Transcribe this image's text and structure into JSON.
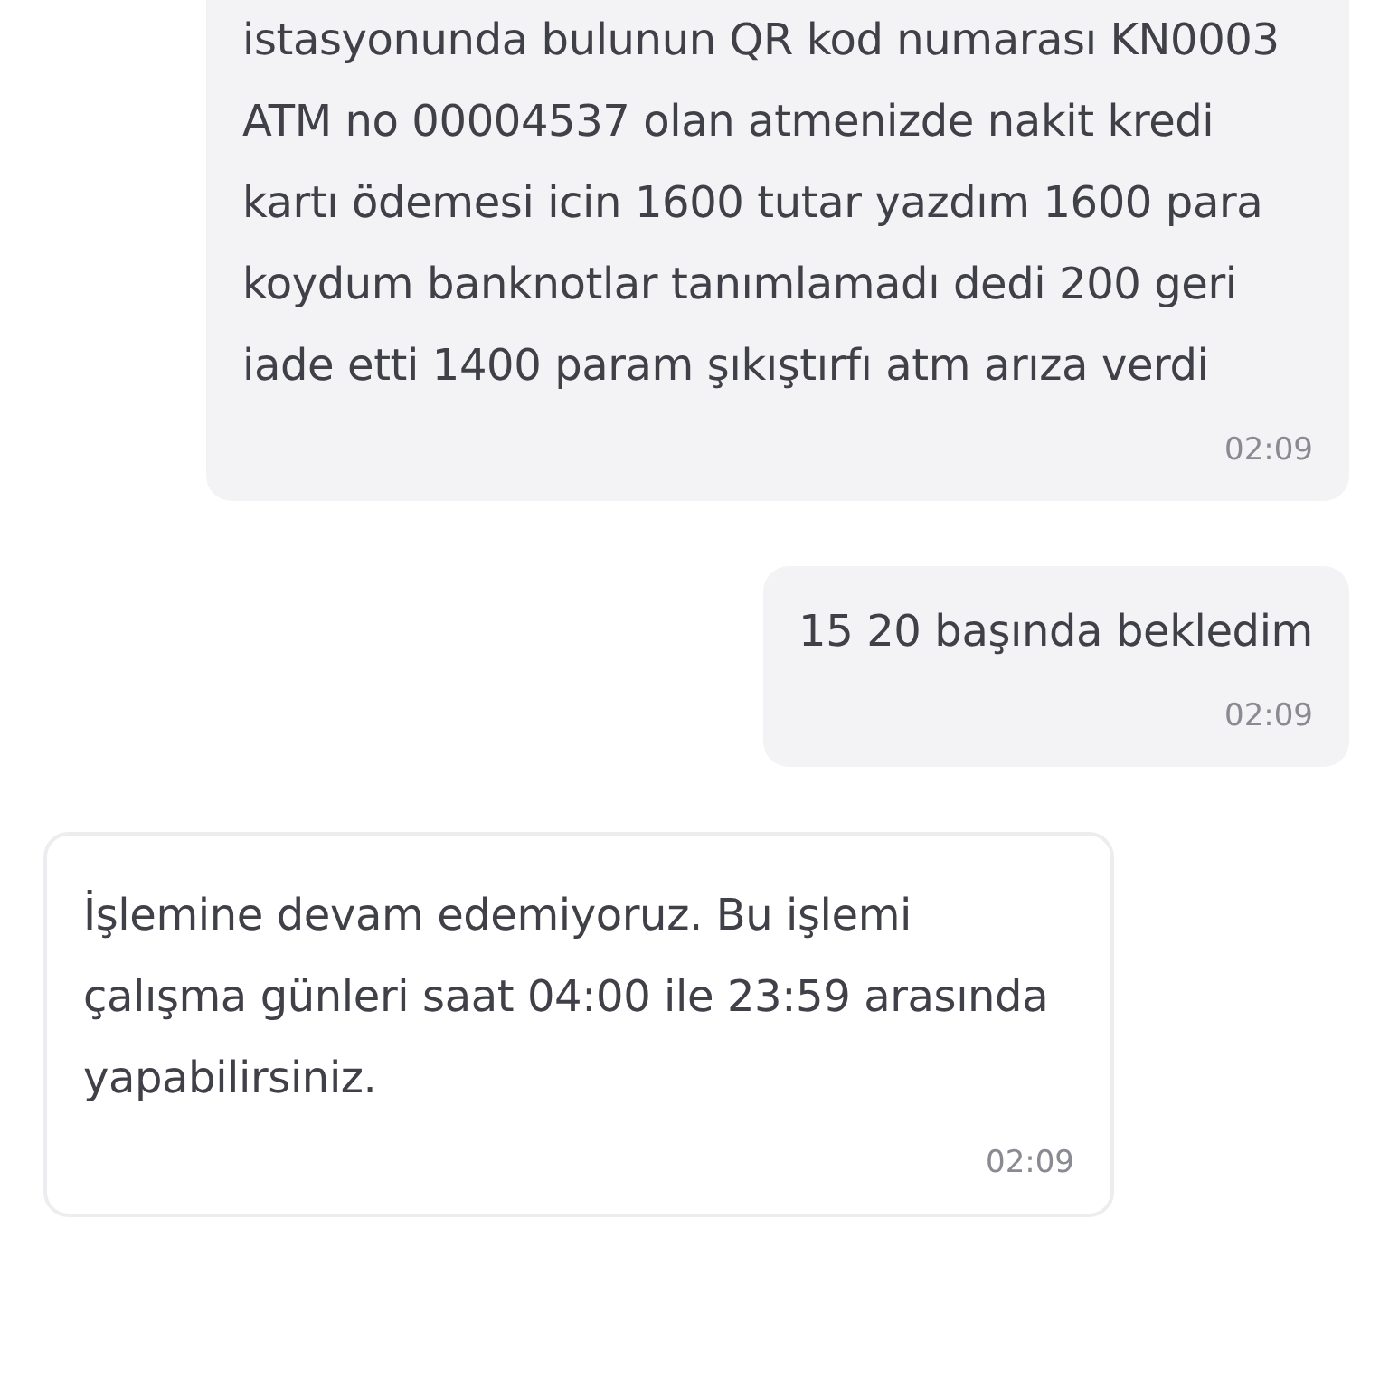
{
  "messages": [
    {
      "kind": "sent",
      "text": "istasyonunda bulunun QR kod numarası KN0003 ATM no 00004537 olan atmenizde nakit kredi kartı ödemesi icin 1600 tutar yazdım 1600 para koydum banknotlar tanımlamadı dedi 200 geri iade etti 1400 param şıkıştırfı atm arıza verdi",
      "time": "02:09"
    },
    {
      "kind": "sent",
      "text": "15 20 başında bekledim",
      "time": "02:09"
    },
    {
      "kind": "received",
      "text": "İşlemine devam edemiyoruz. Bu işlemi çalışma günleri saat 04:00 ile 23:59 arasında yapabilirsiniz.",
      "time": "02:09"
    }
  ]
}
